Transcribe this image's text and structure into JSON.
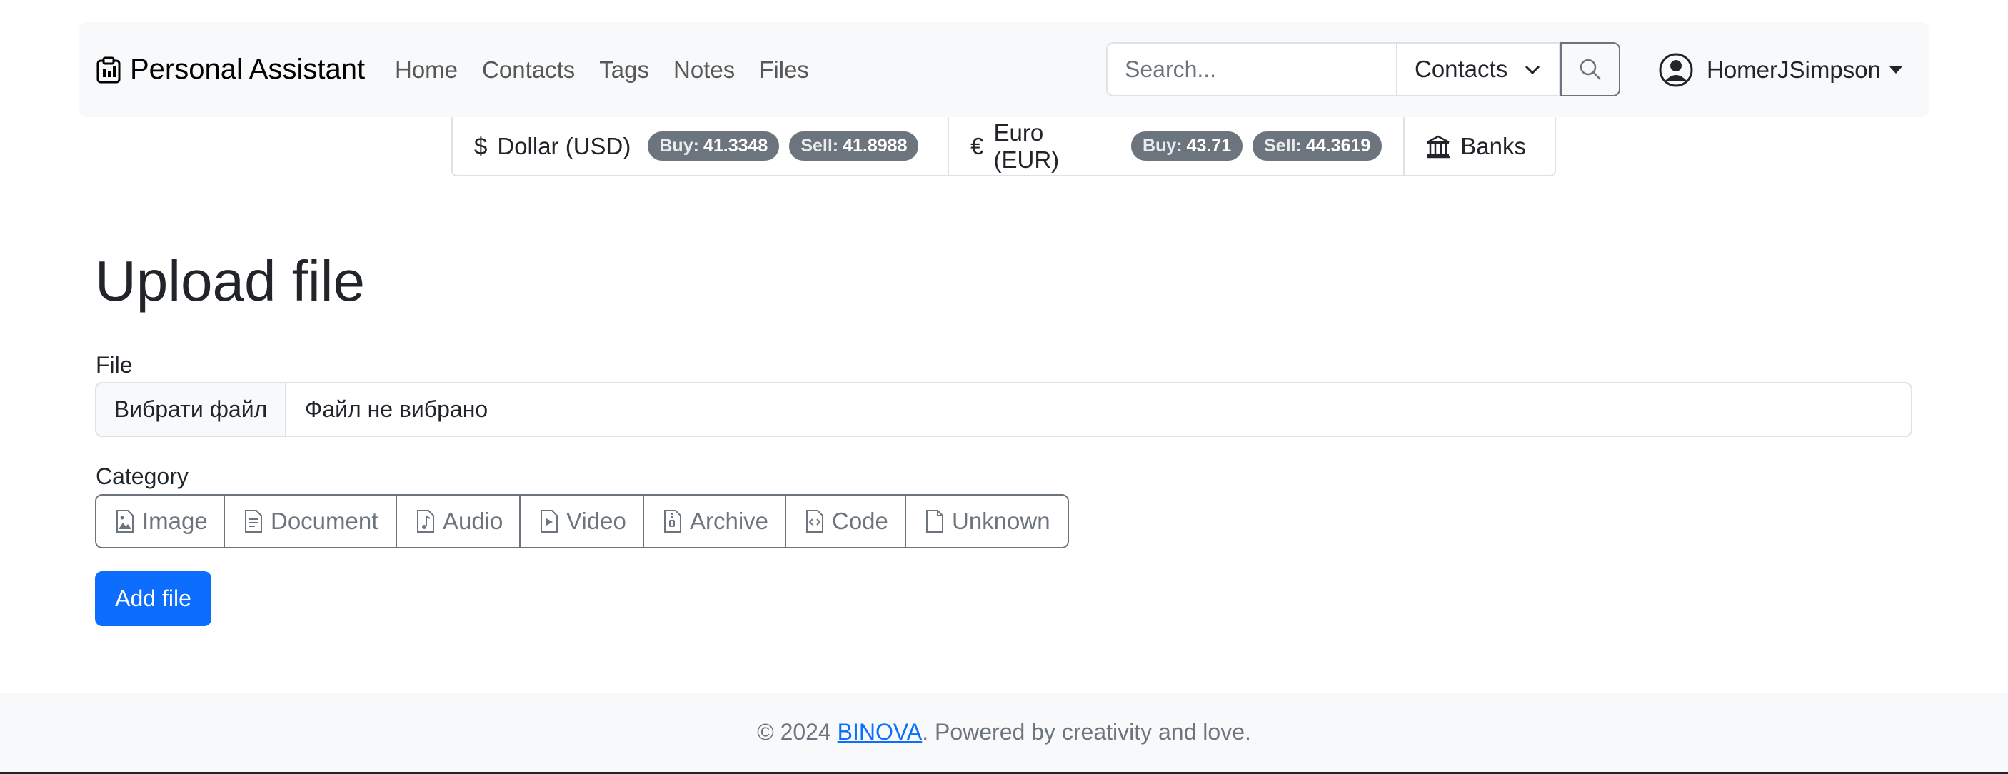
{
  "navbar": {
    "brand": "Personal Assistant",
    "brand_icon": "clipboard-icon",
    "links": [
      "Home",
      "Contacts",
      "Tags",
      "Notes",
      "Files"
    ],
    "search": {
      "placeholder": "Search...",
      "scope": "Contacts"
    },
    "user": "HomerJSimpson"
  },
  "currency": {
    "usd": {
      "symbol": "$",
      "name": "Dollar (USD)",
      "buy_label": "Buy:",
      "buy": "41.3348",
      "sell_label": "Sell:",
      "sell": "41.8988"
    },
    "eur": {
      "symbol": "€",
      "name": "Euro (EUR)",
      "buy_label": "Buy:",
      "buy": "43.71",
      "sell_label": "Sell:",
      "sell": "44.3619"
    },
    "banks_label": "Banks"
  },
  "main": {
    "title": "Upload file",
    "file_label": "File",
    "file_button": "Вибрати файл",
    "file_status": "Файл не вибрано",
    "category_label": "Category",
    "categories": [
      {
        "label": "Image",
        "icon": "image-file-icon"
      },
      {
        "label": "Document",
        "icon": "document-file-icon"
      },
      {
        "label": "Audio",
        "icon": "audio-file-icon"
      },
      {
        "label": "Video",
        "icon": "video-file-icon"
      },
      {
        "label": "Archive",
        "icon": "archive-file-icon"
      },
      {
        "label": "Code",
        "icon": "code-file-icon"
      },
      {
        "label": "Unknown",
        "icon": "blank-file-icon"
      }
    ],
    "submit": "Add file"
  },
  "footer": {
    "prefix": "© 2024 ",
    "link": "BINOVA",
    "suffix": ". Powered by creativity and love."
  },
  "colors": {
    "primary": "#0d6efd",
    "secondary": "#6c757d",
    "navbar_bg": "#f8f9fa"
  }
}
